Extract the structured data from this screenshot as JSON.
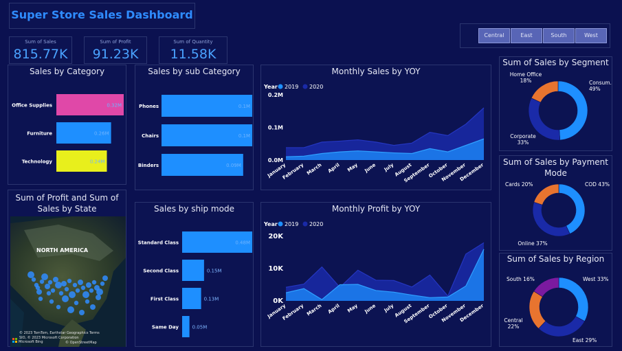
{
  "header": {
    "title": "Super Store Sales Dashboard"
  },
  "kpis": [
    {
      "label": "Sum of Sales",
      "value": "815.77K"
    },
    {
      "label": "Sum of Profit",
      "value": "91.23K"
    },
    {
      "label": "Sum of Quantity",
      "value": "11.58K"
    }
  ],
  "region_slicer": {
    "options": [
      "Central",
      "East",
      "South",
      "West"
    ]
  },
  "map": {
    "title": "Sum of Profit and Sum of Sales by State",
    "region_label": "NORTH AMERICA",
    "attribution_1": "© 2023 TomTom, Earthstar Geographics  Terms",
    "attribution_2": "SIO, © 2023 Microsoft Corporation",
    "attribution_3": "© OpenStreetMap",
    "logo_label": "Microsoft Bing"
  },
  "colors": {
    "background": "#0b1150",
    "accent_blue": "#1e8fff",
    "dark_blue": "#1a2aa8",
    "orange": "#e8742f",
    "magenta": "#e048a8",
    "yellow": "#e8ef1c",
    "purple": "#7b1aa0"
  },
  "chart_data": [
    {
      "id": "sales_by_category",
      "type": "bar",
      "orientation": "horizontal",
      "title": "Sales by Category",
      "categories": [
        "Office Supplies",
        "Furniture",
        "Technology"
      ],
      "values": [
        0.32,
        0.26,
        0.24
      ],
      "data_labels": [
        "0.32M",
        "0.26M",
        "0.24M"
      ],
      "colors": [
        "#e048a8",
        "#1e8fff",
        "#e8ef1c"
      ],
      "unit": "M"
    },
    {
      "id": "sales_by_sub_category",
      "type": "bar",
      "orientation": "horizontal",
      "title": "Sales by sub Category",
      "categories": [
        "Phones",
        "Chairs",
        "Binders"
      ],
      "values": [
        0.1,
        0.1,
        0.09
      ],
      "data_labels": [
        "0.1M",
        "0.1M",
        "0.09M"
      ],
      "unit": "M"
    },
    {
      "id": "sales_by_ship_mode",
      "type": "bar",
      "orientation": "horizontal",
      "title": "Sales by ship mode",
      "categories": [
        "Standard Class",
        "Second Class",
        "First Class",
        "Same Day"
      ],
      "values": [
        0.48,
        0.15,
        0.13,
        0.05
      ],
      "data_labels": [
        "0.48M",
        "0.15M",
        "0.13M",
        "0.05M"
      ],
      "unit": "M"
    },
    {
      "id": "monthly_sales_yoy",
      "type": "area",
      "title": "Monthly Sales by YOY",
      "legend_title": "Year",
      "x": [
        "January",
        "February",
        "March",
        "April",
        "May",
        "June",
        "July",
        "August",
        "September",
        "October",
        "November",
        "December"
      ],
      "y_ticks": [
        "0.0M",
        "0.1M",
        "0.2M"
      ],
      "ylim": [
        0,
        0.2
      ],
      "series": [
        {
          "name": "2019",
          "color": "#1e8fff",
          "values": [
            0.01,
            0.012,
            0.02,
            0.025,
            0.028,
            0.025,
            0.022,
            0.02,
            0.035,
            0.025,
            0.045,
            0.065
          ]
        },
        {
          "name": "2020",
          "color": "#1a2aa8",
          "values": [
            0.038,
            0.038,
            0.055,
            0.058,
            0.062,
            0.055,
            0.045,
            0.052,
            0.085,
            0.075,
            0.11,
            0.16
          ]
        }
      ]
    },
    {
      "id": "monthly_profit_yoy",
      "type": "area",
      "title": "Monthly Profit by YOY",
      "legend_title": "Year",
      "x": [
        "January",
        "February",
        "March",
        "April",
        "May",
        "June",
        "July",
        "August",
        "September",
        "October",
        "November",
        "December"
      ],
      "y_ticks": [
        "0K",
        "10K",
        "20K"
      ],
      "ylim": [
        0,
        20000
      ],
      "series": [
        {
          "name": "2019",
          "color": "#1e8fff",
          "values": [
            2500,
            3800,
            400,
            5000,
            5100,
            3200,
            2700,
            1800,
            1000,
            1200,
            4600,
            16000
          ]
        },
        {
          "name": "2020",
          "color": "#1a2aa8",
          "values": [
            4200,
            5200,
            10500,
            4200,
            9500,
            6400,
            6300,
            4300,
            8000,
            1500,
            14500,
            18000
          ]
        }
      ]
    },
    {
      "id": "sales_by_segment",
      "type": "pie",
      "donut": true,
      "title": "Sum of Sales by Segment",
      "slices": [
        {
          "label": "Consum...",
          "percent": 49,
          "color": "#1e8fff",
          "text": "Consum...\n49%"
        },
        {
          "label": "Corporate",
          "percent": 33,
          "color": "#1a2aa8",
          "text": "Corporate\n33%"
        },
        {
          "label": "Home Office",
          "percent": 18,
          "color": "#e8742f",
          "text": "Home Office\n18%"
        }
      ]
    },
    {
      "id": "sales_by_payment_mode",
      "type": "pie",
      "donut": true,
      "title": "Sum of Sales by Payment Mode",
      "slices": [
        {
          "label": "COD",
          "percent": 43,
          "color": "#1e8fff",
          "text": "COD 43%"
        },
        {
          "label": "Online",
          "percent": 37,
          "color": "#1a2aa8",
          "text": "Online 37%"
        },
        {
          "label": "Cards",
          "percent": 20,
          "color": "#e8742f",
          "text": "Cards 20%"
        }
      ]
    },
    {
      "id": "sales_by_region",
      "type": "pie",
      "donut": true,
      "title": "Sum of Sales by Region",
      "slices": [
        {
          "label": "West",
          "percent": 33,
          "color": "#1e8fff",
          "text": "West 33%"
        },
        {
          "label": "East",
          "percent": 29,
          "color": "#1a2aa8",
          "text": "East 29%"
        },
        {
          "label": "Central",
          "percent": 22,
          "color": "#e8742f",
          "text": "Central\n22%"
        },
        {
          "label": "South",
          "percent": 16,
          "color": "#7b1aa0",
          "text": "South 16%"
        }
      ]
    }
  ]
}
